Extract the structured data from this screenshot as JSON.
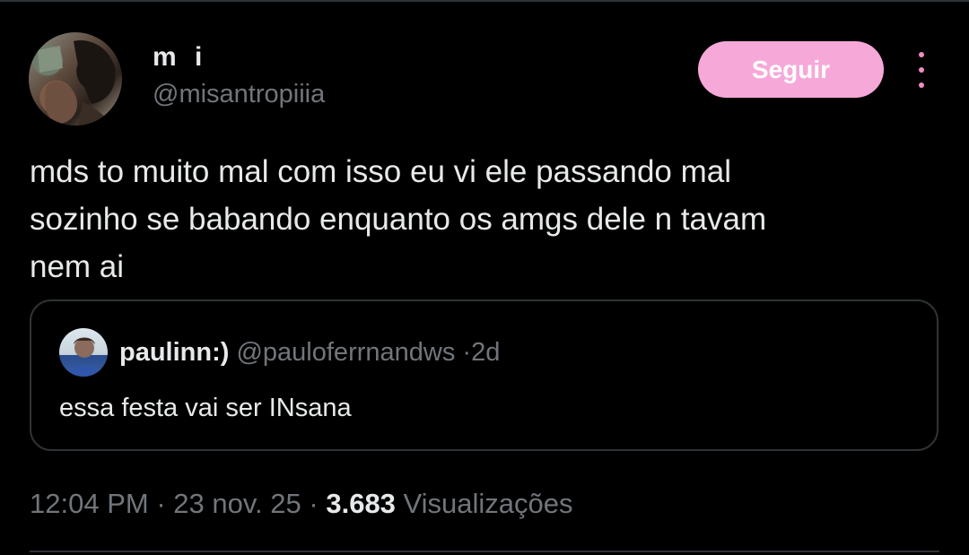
{
  "author": {
    "display_name": "m i",
    "handle": "@misantropiiia",
    "avatar_icon": "profile-photo"
  },
  "follow_button_label": "Seguir",
  "more_icon": "more-vertical-icon",
  "tweet": {
    "lines": [
      "mds to muito mal com isso eu vi ele passando mal",
      "sozinho se babando enquanto os amgs dele n tavam",
      "nem ai"
    ]
  },
  "quoted_tweet": {
    "display_name": "paulinn:)",
    "handle": "@pauloferrnandws",
    "separator": "·",
    "time": "2d",
    "text": "essa festa vai ser INsana"
  },
  "meta": {
    "time": "12:04 PM",
    "sep1": "·",
    "date": "23 nov. 25",
    "sep2": "·",
    "views_count": "3.683",
    "views_label": "Visualizações"
  },
  "colors": {
    "background": "#000000",
    "follow_button": "#f6a8d8",
    "more_dots": "#f08cc6",
    "secondary_text": "#71767b",
    "primary_text": "#e7e9ea",
    "border": "#2f3336"
  }
}
